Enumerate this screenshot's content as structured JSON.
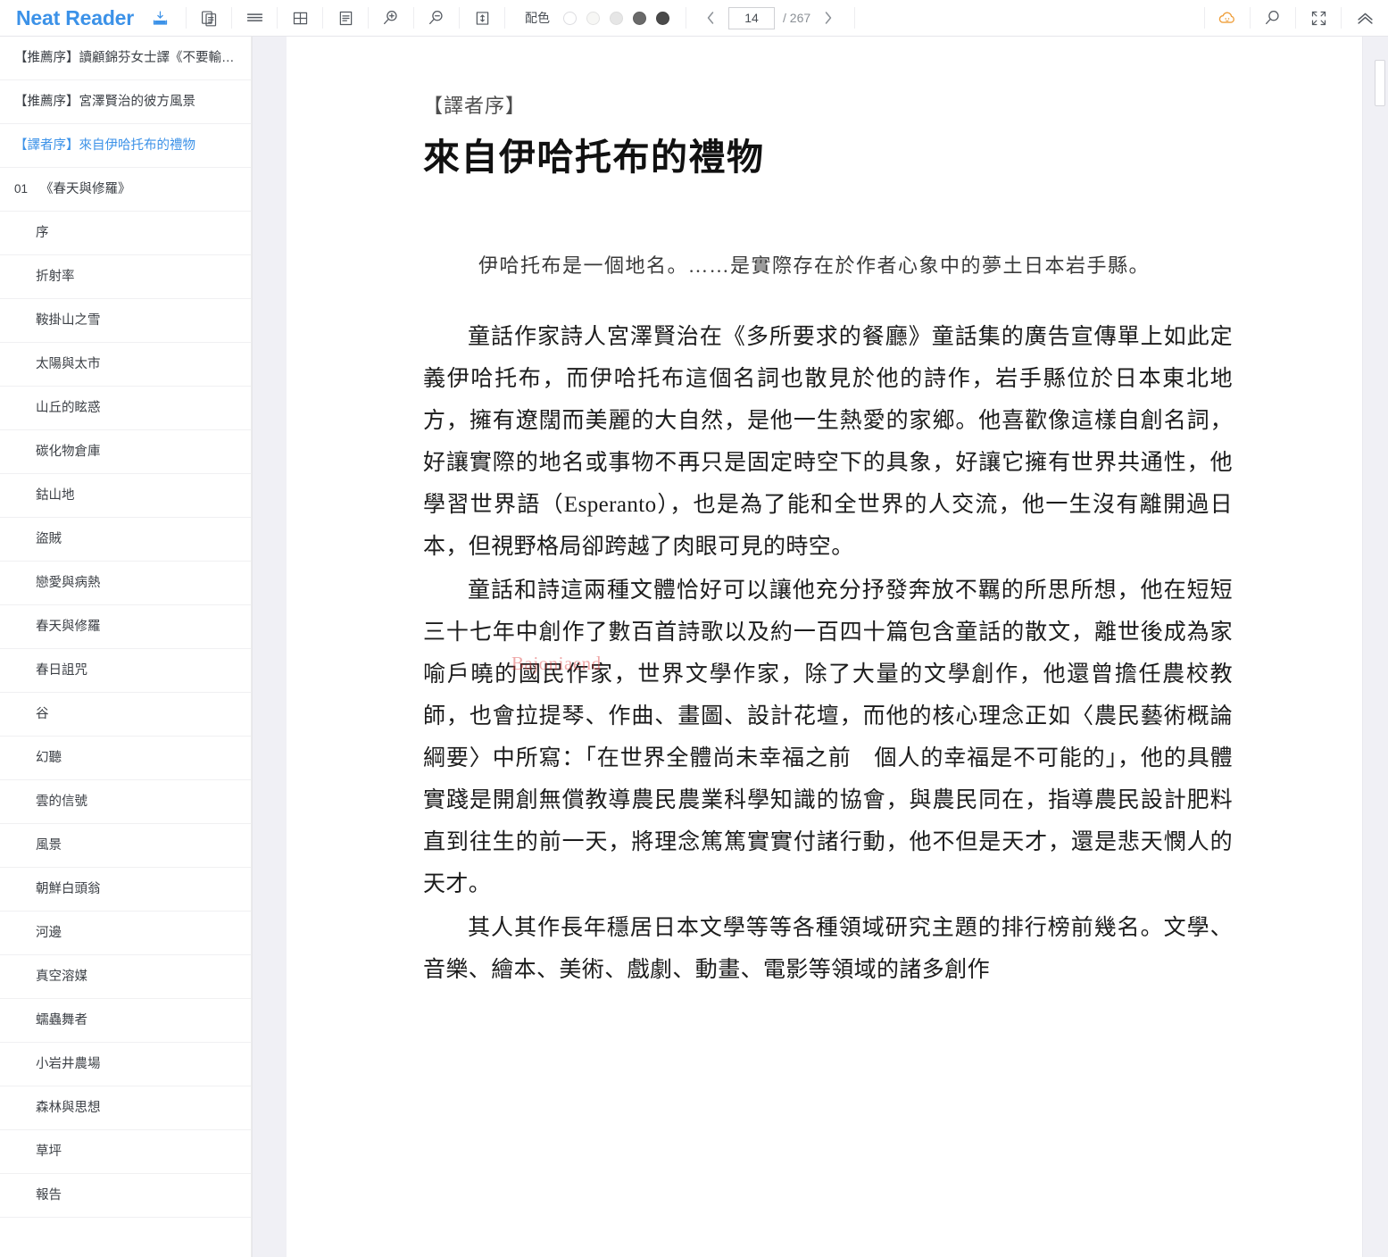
{
  "app": {
    "brand": "Neat Reader",
    "toolbar": {
      "download_icon": "download-icon",
      "buttons": [
        {
          "name": "copy-pages-icon",
          "label": "copy-pages"
        },
        {
          "name": "lines-icon",
          "label": "scroll-mode"
        },
        {
          "name": "grid-icon",
          "label": "grid-view"
        },
        {
          "name": "text-layout-icon",
          "label": "text-layout"
        },
        {
          "name": "zoom-in-icon",
          "label": "zoom-in"
        },
        {
          "name": "zoom-out-icon",
          "label": "zoom-out"
        },
        {
          "name": "line-height-icon",
          "label": "line-height"
        }
      ],
      "theme": {
        "label": "配色",
        "dots": [
          "#ffffff",
          "#f7f7f5",
          "#e6e6e6",
          "#6a6a6a",
          "#4a4a4a"
        ],
        "selected_index": 0
      },
      "pager": {
        "prev": "‹",
        "next": "›",
        "current_page": "14",
        "total_label": "/ 267"
      },
      "right_buttons": [
        {
          "name": "cloud-icon",
          "label": "cloud-sync",
          "color": "#ef9f3c"
        },
        {
          "name": "search-icon",
          "label": "search"
        },
        {
          "name": "fullscreen-icon",
          "label": "fullscreen"
        },
        {
          "name": "collapse-up-icon",
          "label": "collapse-toolbar"
        }
      ]
    }
  },
  "sidebar": {
    "items": [
      {
        "num": "",
        "label": "【推薦序】讀顧錦芬女士譯《不要輸給…",
        "level": 0,
        "active": false
      },
      {
        "num": "",
        "label": "【推薦序】宮澤賢治的彼方風景",
        "level": 0,
        "active": false
      },
      {
        "num": "",
        "label": "【譯者序】來自伊哈托布的禮物",
        "level": 0,
        "active": true
      },
      {
        "num": "01",
        "label": "《春天與修羅》",
        "level": 1,
        "active": false
      },
      {
        "num": "",
        "label": "序",
        "level": 2,
        "active": false
      },
      {
        "num": "",
        "label": "折射率",
        "level": 2,
        "active": false
      },
      {
        "num": "",
        "label": "鞍掛山之雪",
        "level": 2,
        "active": false
      },
      {
        "num": "",
        "label": "太陽與太市",
        "level": 2,
        "active": false
      },
      {
        "num": "",
        "label": "山丘的眩惑",
        "level": 2,
        "active": false
      },
      {
        "num": "",
        "label": "碳化物倉庫",
        "level": 2,
        "active": false
      },
      {
        "num": "",
        "label": "鈷山地",
        "level": 2,
        "active": false
      },
      {
        "num": "",
        "label": "盜賊",
        "level": 2,
        "active": false
      },
      {
        "num": "",
        "label": "戀愛與病熱",
        "level": 2,
        "active": false
      },
      {
        "num": "",
        "label": "春天與修羅",
        "level": 2,
        "active": false
      },
      {
        "num": "",
        "label": "春日詛咒",
        "level": 2,
        "active": false
      },
      {
        "num": "",
        "label": "谷",
        "level": 2,
        "active": false
      },
      {
        "num": "",
        "label": "幻聽",
        "level": 2,
        "active": false
      },
      {
        "num": "",
        "label": "雲的信號",
        "level": 2,
        "active": false
      },
      {
        "num": "",
        "label": "風景",
        "level": 2,
        "active": false
      },
      {
        "num": "",
        "label": "朝鮮白頭翁",
        "level": 2,
        "active": false
      },
      {
        "num": "",
        "label": "河邊",
        "level": 2,
        "active": false
      },
      {
        "num": "",
        "label": "真空溶媒",
        "level": 2,
        "active": false
      },
      {
        "num": "",
        "label": "蠕蟲舞者",
        "level": 2,
        "active": false
      },
      {
        "num": "",
        "label": "小岩井農場",
        "level": 2,
        "active": false
      },
      {
        "num": "",
        "label": "森林與思想",
        "level": 2,
        "active": false
      },
      {
        "num": "",
        "label": "草坪",
        "level": 2,
        "active": false
      },
      {
        "num": "",
        "label": "報告",
        "level": 2,
        "active": false
      }
    ]
  },
  "content": {
    "kicker": "【譯者序】",
    "title": "來自伊哈托布的禮物",
    "epigraph": "伊哈托布是一個地名。……是實際存在於作者心象中的夢土日本岩手縣。",
    "paragraphs": [
      "童話作家詩人宮澤賢治在《多所要求的餐廳》童話集的廣告宣傳單上如此定義伊哈托布，而伊哈托布這個名詞也散見於他的詩作，岩手縣位於日本東北地方，擁有遼闊而美麗的大自然，是他一生熱愛的家鄉。他喜歡像這樣自創名詞，好讓實際的地名或事物不再只是固定時空下的具象，好讓它擁有世界共通性，他學習世界語（Esperanto），也是為了能和全世界的人交流，他一生沒有離開過日本，但視野格局卻跨越了肉眼可見的時空。",
      "童話和詩這兩種文體恰好可以讓他充分抒發奔放不羈的所思所想，他在短短三十七年中創作了數百首詩歌以及約一百四十篇包含童話的散文，離世後成為家喻戶曉的國民作家，世界文學作家，除了大量的文學創作，他還曾擔任農校教師，也會拉提琴、作曲、畫圖、設計花壇，而他的核心理念正如〈農民藝術概論綱要〉中所寫：「在世界全體尚未幸福之前　個人的幸福是不可能的」，他的具體實踐是開創無償教導農民農業科學知識的協會，與農民同在，指導農民設計肥料直到往生的前一天，將理念篤篤實實付諸行動，他不但是天才，還是悲天憫人的天才。",
      "其人其作長年穩居日本文學等等各種領域研究主題的排行榜前幾名。文學、音樂、繪本、美術、戲劇、動畫、電影等領域的諸多創作"
    ],
    "watermark": "Bajoniaend"
  }
}
